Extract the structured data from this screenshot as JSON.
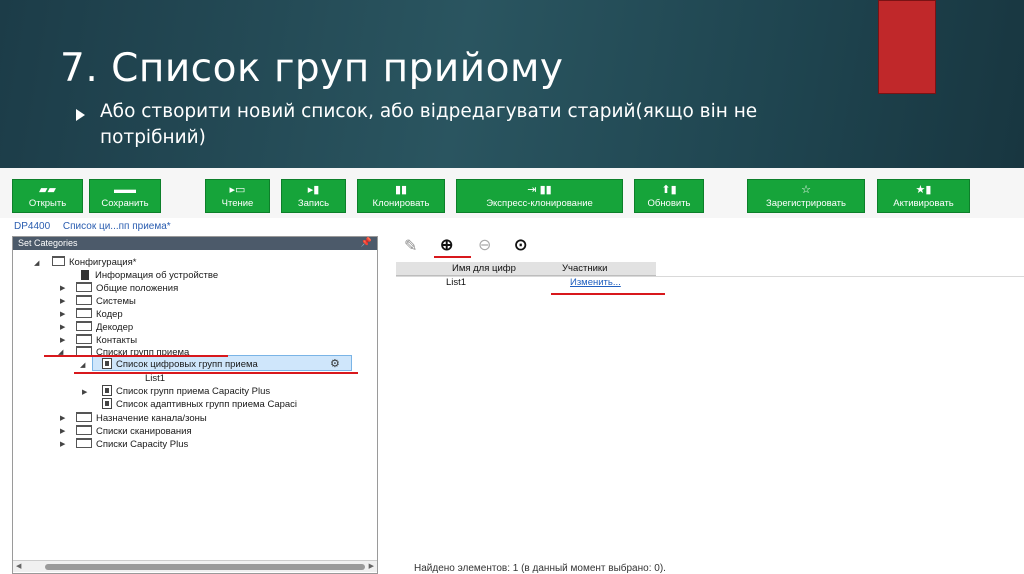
{
  "slide": {
    "title": "7. Список груп прийому",
    "subtitle": "Або створити новий список, або відредагувати старий(якщо він не потрібний)"
  },
  "toolbar": {
    "buttons": [
      {
        "label": "Открыть",
        "icon": "folder-open-icon",
        "glyph": "▰▰"
      },
      {
        "label": "Сохранить",
        "icon": "save-icon",
        "glyph": "▬▬"
      },
      {
        "label": "Чтение",
        "icon": "read-icon",
        "glyph": "▸▭"
      },
      {
        "label": "Запись",
        "icon": "write-icon",
        "glyph": "▸▮"
      },
      {
        "label": "Клонировать",
        "icon": "clone-icon",
        "glyph": "▮▮"
      },
      {
        "label": "Экспресс-клонирование",
        "icon": "express-clone-icon",
        "glyph": "⇥ ▮▮"
      },
      {
        "label": "Обновить",
        "icon": "update-icon",
        "glyph": "⬆▮"
      },
      {
        "label": "Зарегистрировать",
        "icon": "register-icon",
        "glyph": "☆"
      },
      {
        "label": "Активировать",
        "icon": "activate-icon",
        "glyph": "★▮"
      }
    ]
  },
  "breadcrumb": [
    "DP4400",
    "Список ци...пп приема*"
  ],
  "left_panel": {
    "title": "Set Categories",
    "tree": [
      "Конфигурация*",
      "Информация об устройстве",
      "Общие положения",
      "Системы",
      "Кодер",
      "Декодер",
      "Контакты",
      "Списки групп приема",
      "Список цифровых групп приема",
      "List1",
      "Список групп приема Capacity Plus",
      "Список адаптивных групп приема Capaci",
      "Назначение канала/зоны",
      "Списки сканирования",
      "Списки Capacity Plus"
    ]
  },
  "right_panel": {
    "columns": [
      "Имя для цифр",
      "Участники"
    ],
    "rows": [
      {
        "name": "List1",
        "members": "Изменить..."
      }
    ],
    "status": "Найдено элементов: 1 (в данный момент выбрано: 0)."
  },
  "colors": {
    "toolbar_green": "#16a43a",
    "accent_red": "#c0282a",
    "header_dark": "#1f4550",
    "annotation_red": "#d8181c"
  }
}
